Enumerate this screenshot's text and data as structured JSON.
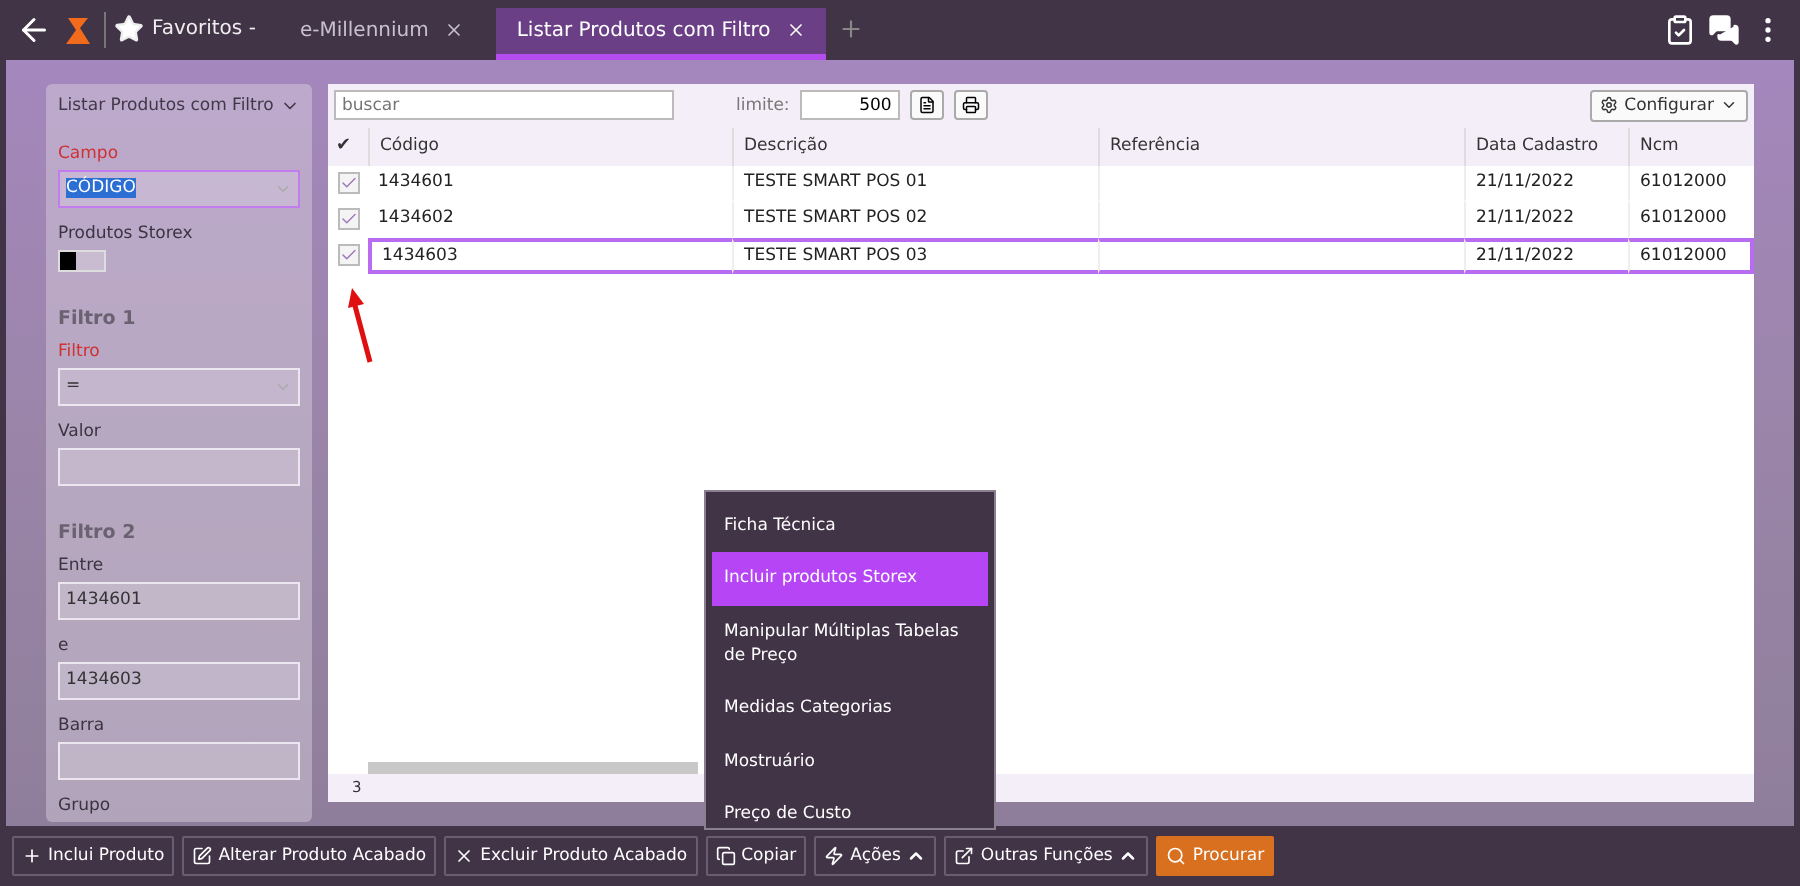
{
  "top_bar": {
    "favorites": "Favoritos -",
    "tabs": [
      {
        "label": "e-Millennium",
        "selected": false
      },
      {
        "label": "Listar Produtos com Filtro",
        "selected": true
      }
    ]
  },
  "filter_panel": {
    "title": "Listar Produtos com Filtro",
    "fields": [
      {
        "kind": "select",
        "label": "Campo",
        "required": true,
        "value": "CÓDIGO",
        "highlighted": true
      },
      {
        "kind": "toggle",
        "label": "Produtos Storex",
        "on": false
      },
      {
        "kind": "heading",
        "label": "Filtro 1"
      },
      {
        "kind": "select",
        "label": "Filtro",
        "required": true,
        "value": "="
      },
      {
        "kind": "input",
        "label": "Valor",
        "required": false
      },
      {
        "kind": "heading",
        "label": "Filtro 2"
      },
      {
        "kind": "input",
        "label": "Entre",
        "required": false,
        "value": "1434601"
      },
      {
        "kind": "input",
        "label": "e",
        "required": false,
        "value": "1434603"
      },
      {
        "kind": "input",
        "label": "Barra",
        "required": false
      },
      {
        "kind": "label",
        "label": "Grupo",
        "required": false
      }
    ]
  },
  "grid": {
    "search": {
      "placeholder": "buscar"
    },
    "limit_label": "limite:",
    "limit": "500",
    "configure": "Configurar",
    "check_header": "✔",
    "columns": [
      "Código",
      "Descrição",
      "Referência",
      "Data Cadastro",
      "Ncm"
    ],
    "rows": [
      {
        "checked": true,
        "selected": false,
        "cells": [
          "1434601",
          "TESTE SMART POS 01",
          "",
          "21/11/2022",
          "61012000"
        ]
      },
      {
        "checked": true,
        "selected": false,
        "cells": [
          "1434602",
          "TESTE SMART POS 02",
          "",
          "21/11/2022",
          "61012000"
        ]
      },
      {
        "checked": true,
        "selected": true,
        "cells": [
          "1434603",
          "TESTE SMART POS 03",
          "",
          "21/11/2022",
          "61012000"
        ]
      }
    ],
    "count": "3"
  },
  "menu": {
    "items": [
      {
        "label": "Ficha Técnica",
        "selected": false
      },
      {
        "label": "Incluir produtos Storex",
        "selected": true
      },
      {
        "label": "Manipular Múltiplas Tabelas de Preço",
        "selected": false
      },
      {
        "label": "Medidas Categorias",
        "selected": false
      },
      {
        "label": "Mostruário",
        "selected": false
      },
      {
        "label": "Preço de Custo",
        "selected": false
      }
    ]
  },
  "actions": [
    {
      "label": "Inclui Produto",
      "kind": "plus",
      "caret": false,
      "primary": false
    },
    {
      "label": "Alterar Produto Acabado",
      "kind": "edit",
      "caret": false,
      "primary": false
    },
    {
      "label": "Excluir Produto Acabado",
      "kind": "delete",
      "caret": false,
      "primary": false
    },
    {
      "label": "Copiar",
      "kind": "copy",
      "caret": false,
      "primary": false
    },
    {
      "label": "Ações",
      "kind": "actions",
      "caret": true,
      "primary": false
    },
    {
      "label": "Outras Funções",
      "kind": "other",
      "caret": true,
      "primary": false
    },
    {
      "label": "Procurar",
      "kind": "search",
      "caret": false,
      "primary": true
    }
  ]
}
